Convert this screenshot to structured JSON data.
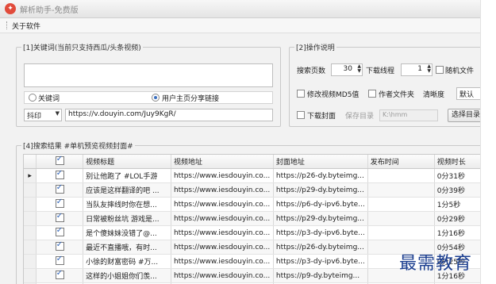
{
  "window": {
    "title": "解析助手-免费版",
    "app_icon": "logo-icon"
  },
  "menu": {
    "about": "关于软件"
  },
  "keyword_group": {
    "label": "[1]关键词(当前只支持西瓜/头条视频)",
    "keyword_value": "",
    "radio_keyword": "关键词",
    "radio_user_url": "用户主页分享链接",
    "selected_radio": "user_url",
    "platform_select": "抖印",
    "url_value": "https://v.douyin.com/Juy9KgR/"
  },
  "ops_group": {
    "label": "[2]操作说明",
    "search_pages_label": "搜索页数",
    "search_pages_value": "30",
    "threads_label": "下载线程",
    "threads_value": "1",
    "random_file_label": "随机文件",
    "modify_md5_label": "修改视频MD5值",
    "author_folder_label": "作者文件夹",
    "clarity_label": "清晰度",
    "clarity_value": "默认",
    "download_cover_label": "下载封面",
    "save_dir_label": "保存目录",
    "save_dir_value": "K:\\hmm",
    "choose_dir_button": "选择目录"
  },
  "results_group": {
    "label": "[4]搜索结果 #单机预览视频封面#",
    "columns": [
      "",
      "",
      "视频标题",
      "视频地址",
      "封面地址",
      "发布时间",
      "视频时长"
    ],
    "rows": [
      {
        "title": "别让他跑了 #LOL手游",
        "video": "https://www.iesdouyin.co...",
        "cover": "https://p26-dy.byteimg...",
        "time": "",
        "duration": "0分31秒",
        "current": true
      },
      {
        "title": "应该是这样翻译的吧 ...",
        "video": "https://www.iesdouyin.co...",
        "cover": "https://p29-dy.byteimg...",
        "time": "",
        "duration": "0分39秒",
        "current": false
      },
      {
        "title": "当队友摔线时你在想...",
        "video": "https://www.iesdouyin.co...",
        "cover": "https://p6-dy-ipv6.byte...",
        "time": "",
        "duration": "1分5秒",
        "current": false
      },
      {
        "title": "日常被粉丝坑 游戏是...",
        "video": "https://www.iesdouyin.co...",
        "cover": "https://p29-dy.byteimg...",
        "time": "",
        "duration": "0分29秒",
        "current": false
      },
      {
        "title": "是个傻妹妹没错了@...",
        "video": "https://www.iesdouyin.co...",
        "cover": "https://p3-dy-ipv6.byte...",
        "time": "",
        "duration": "1分16秒",
        "current": false
      },
      {
        "title": "最近不直播哦，有时...",
        "video": "https://www.iesdouyin.co...",
        "cover": "https://p26-dy.byteimg...",
        "time": "",
        "duration": "0分54秒",
        "current": false
      },
      {
        "title": "小徐的财富密码 #万...",
        "video": "https://www.iesdouyin.co...",
        "cover": "https://p3-dy-ipv6.byte...",
        "time": "",
        "duration": "0分25秒",
        "current": false
      },
      {
        "title": "这样的小姐姐你们羡...",
        "video": "https://www.iesdouyin.co...",
        "cover": "https://p9-dy.byteimg...",
        "time": "",
        "duration": "1分16秒",
        "current": false
      },
      {
        "title": "猜猜谁是内鬼 游戏#a...",
        "video": "https://www.iesdouyin.co...",
        "cover": "https://p3-dy-ipv6.byte...",
        "time": "",
        "duration": "1分9秒",
        "current": false
      }
    ]
  },
  "watermark": "最需教育",
  "colors": {
    "accent": "#2f63b7",
    "watermark": "#1a3d8f",
    "app_icon": "#e14b3b"
  }
}
